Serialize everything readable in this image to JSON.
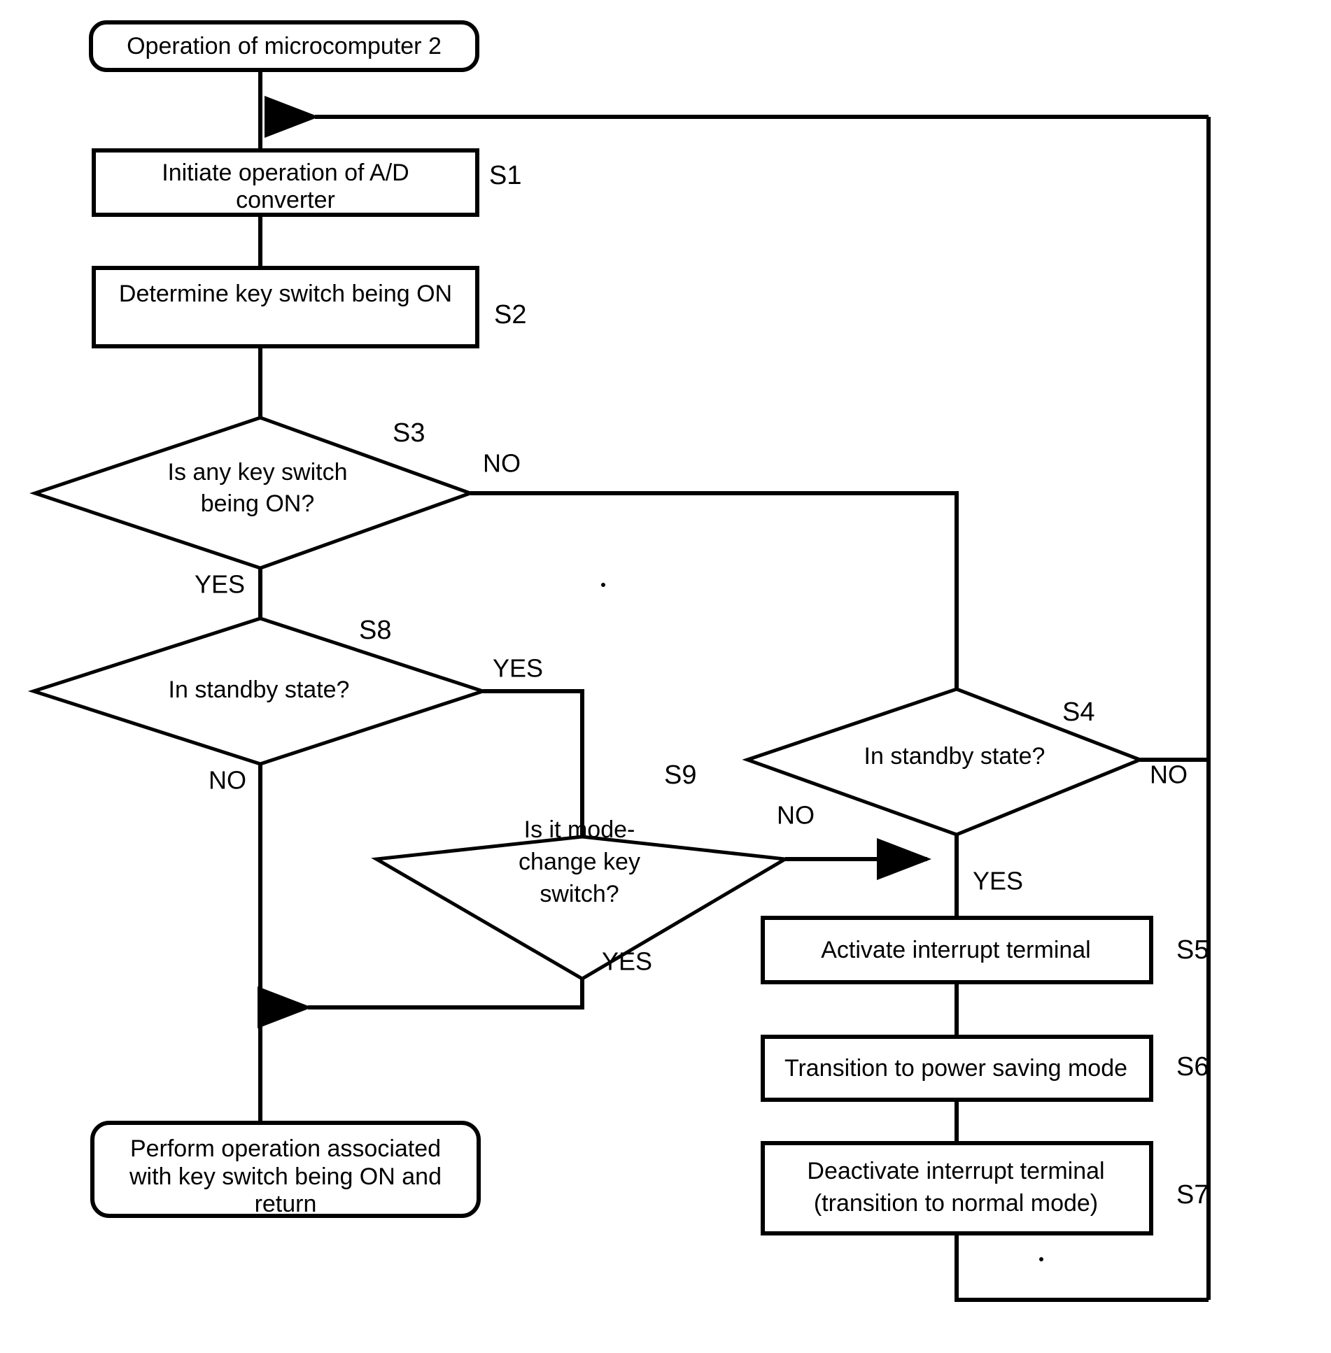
{
  "diagram": {
    "title": "Operation of microcomputer 2 flowchart",
    "nodes": {
      "start": {
        "label": "Operation of microcomputer 2",
        "shape": "rounded-rect"
      },
      "s1": {
        "label_line1": "Initiate operation of A/D",
        "label_line2": "converter",
        "step": "S1",
        "shape": "rect"
      },
      "s2": {
        "label": "Determine key switch being ON",
        "step": "S2",
        "shape": "rect"
      },
      "s3": {
        "label_line1": "Is any key switch",
        "label_line2": "being ON?",
        "step": "S3",
        "shape": "diamond",
        "yes": "YES",
        "no": "NO"
      },
      "s8": {
        "label": "In standby state?",
        "step": "S8",
        "shape": "diamond",
        "yes": "YES",
        "no": "NO"
      },
      "s9": {
        "label_line1": "Is it mode-",
        "label_line2": "change key",
        "label_line3": "switch?",
        "step": "S9",
        "shape": "diamond",
        "yes": "YES",
        "no": "NO"
      },
      "s4": {
        "label": "In standby state?",
        "step": "S4",
        "shape": "diamond",
        "yes": "YES",
        "no": "NO"
      },
      "s5": {
        "label": "Activate interrupt terminal",
        "step": "S5",
        "shape": "rect"
      },
      "s6": {
        "label": "Transition to power saving mode",
        "step": "S6",
        "shape": "rect"
      },
      "s7": {
        "label_line1": "Deactivate interrupt terminal",
        "label_line2": "(transition to normal mode)",
        "step": "S7",
        "shape": "rect"
      },
      "end": {
        "label_line1": "Perform operation associated",
        "label_line2": "with key switch being ON and",
        "label_line3": "return",
        "shape": "rounded-rect"
      }
    },
    "colors": {
      "stroke": "#000000",
      "fill": "#ffffff",
      "text": "#000000"
    }
  }
}
